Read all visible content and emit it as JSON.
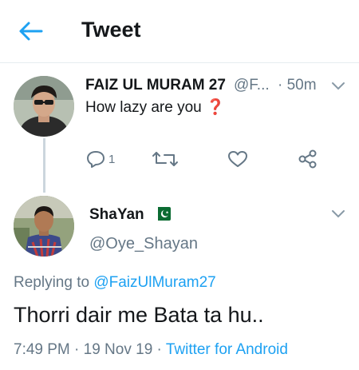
{
  "header": {
    "title": "Tweet",
    "back_icon": "arrow-left-icon",
    "accent": "#1da1f2"
  },
  "parent_tweet": {
    "name": "FAIZ UL MURAM 27",
    "handle": "@F...",
    "time": "· 50m",
    "text": "How lazy are you",
    "emoji": "❓",
    "actions": {
      "reply_count": "1",
      "icons": [
        "reply-icon",
        "retweet-icon",
        "like-icon",
        "share-icon"
      ]
    }
  },
  "main_tweet": {
    "name": "ShaYan",
    "flag": "pakistan-flag-icon",
    "handle": "@Oye_Shayan",
    "replying_prefix": "Replying to",
    "replying_to": "@FaizUlMuram27",
    "text": "Thorri dair me Bata ta hu..",
    "timestamp": "7:49 PM · 19 Nov 19 ·",
    "source": "Twitter for Android"
  },
  "colors": {
    "text": "#14171a",
    "secondary": "#657786",
    "link": "#1da1f2",
    "divider": "#e6ecf0"
  }
}
